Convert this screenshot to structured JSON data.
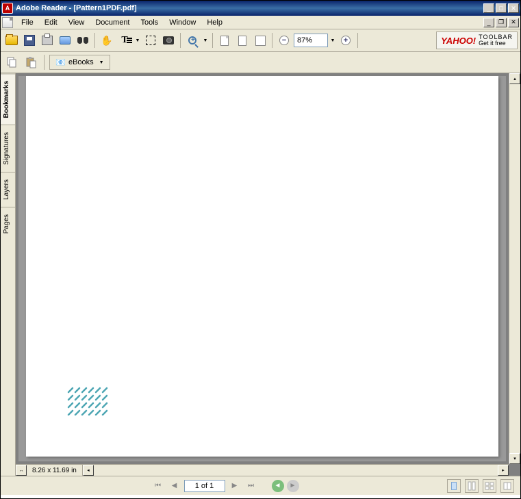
{
  "title": "Adobe Reader - [Pattern1PDF.pdf]",
  "menu": {
    "file": "File",
    "edit": "Edit",
    "view": "View",
    "document": "Document",
    "tools": "Tools",
    "window": "Window",
    "help": "Help"
  },
  "toolbar": {
    "zoom_value": "87%",
    "ebooks_label": "eBooks",
    "yahoo_brand": "YAHOO!",
    "yahoo_toolbar": "TOOLBAR",
    "yahoo_tagline": "Get it free"
  },
  "sidebar": {
    "tabs": [
      "Bookmarks",
      "Signatures",
      "Layers",
      "Pages"
    ]
  },
  "document": {
    "page_dimensions": "8.26 x 11.69 in"
  },
  "statusbar": {
    "page_display": "1 of 1"
  }
}
